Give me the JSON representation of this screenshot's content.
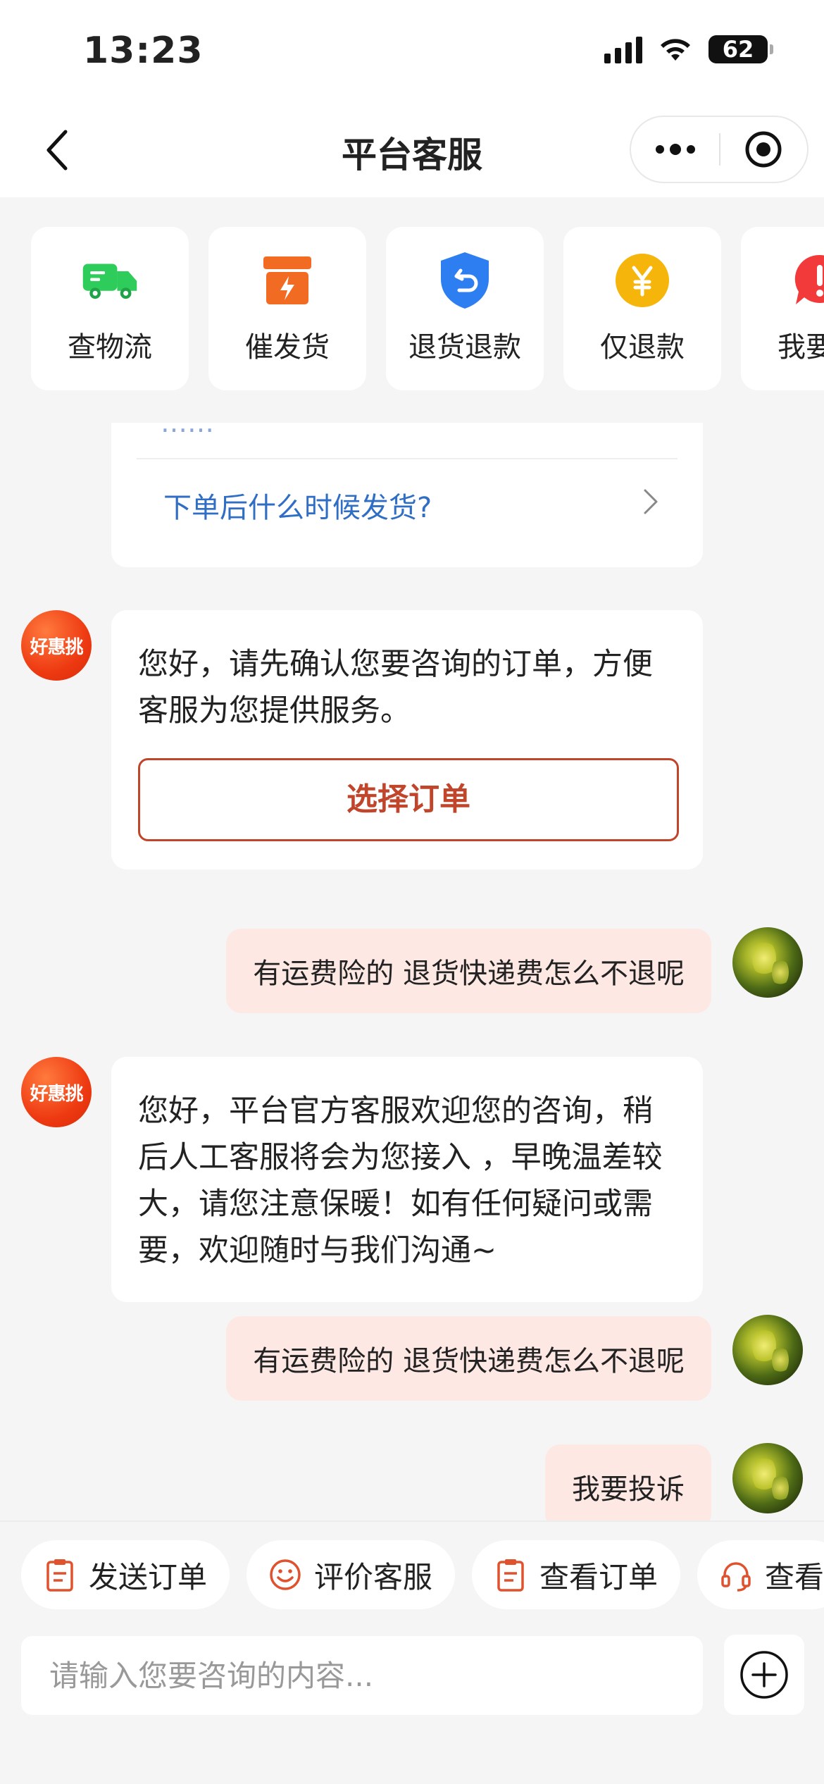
{
  "status_bar": {
    "time": "13:23",
    "battery": "62"
  },
  "header": {
    "title": "平台客服",
    "back_icon": "chevron-left-icon",
    "more_icon": "more-dots-icon",
    "close_icon": "target-circle-icon"
  },
  "quick_actions": [
    {
      "label": "查物流",
      "icon": "truck-icon",
      "color": "#2ecc5a"
    },
    {
      "label": "催发货",
      "icon": "box-lightning-icon",
      "color": "#f26b22"
    },
    {
      "label": "退货退款",
      "icon": "shield-return-icon",
      "color": "#2d7ef0"
    },
    {
      "label": "仅退款",
      "icon": "yen-coin-icon",
      "color": "#f5b50a"
    },
    {
      "label": "我要投",
      "icon": "alert-bubble-icon",
      "color": "#f23a3a"
    }
  ],
  "faq_card": {
    "partial_text": "……",
    "question": "下单后什么时候发货?"
  },
  "messages": [
    {
      "role": "bot",
      "avatar_text": "好惠挑",
      "text": "您好，请先确认您要咨询的订单，方便客服为您提供服务。",
      "button_label": "选择订单"
    },
    {
      "role": "user",
      "text": "有运费险的 退货快递费怎么不退呢"
    },
    {
      "role": "bot",
      "avatar_text": "好惠挑",
      "text": "您好，平台官方客服欢迎您的咨询，稍后人工客服将会为您接入 ，早晚温差较大，请您注意保暖！如有任何疑问或需要，欢迎随时与我们沟通~"
    },
    {
      "role": "user",
      "text": "有运费险的 退货快递费怎么不退呢"
    },
    {
      "role": "user",
      "text": "我要投诉"
    }
  ],
  "chips": [
    {
      "label": "发送订单",
      "icon": "clipboard-icon"
    },
    {
      "label": "评价客服",
      "icon": "smile-icon"
    },
    {
      "label": "查看订单",
      "icon": "clipboard-icon"
    },
    {
      "label": "查看",
      "icon": "headset-icon"
    }
  ],
  "input": {
    "placeholder": "请输入您要咨询的内容...",
    "value": ""
  },
  "accent_color": "#c0452a"
}
